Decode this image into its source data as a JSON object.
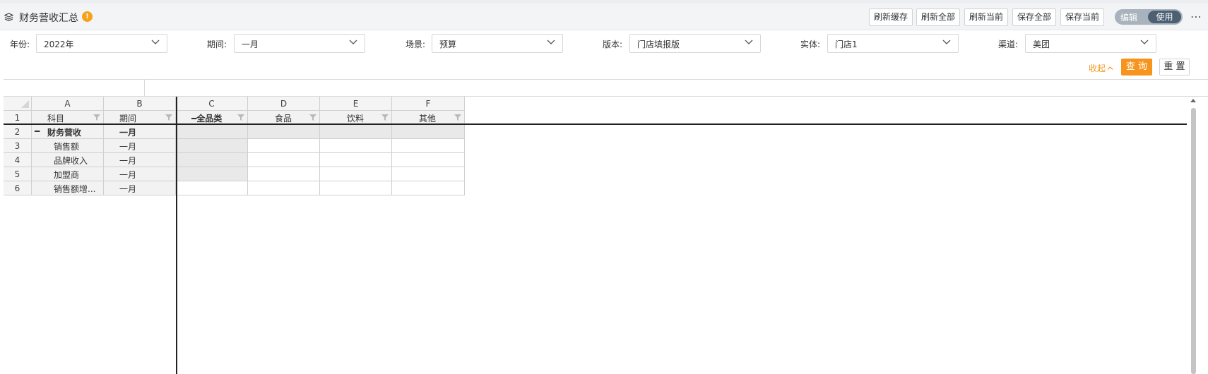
{
  "header": {
    "title": "财务营收汇总",
    "info_badge": "!",
    "buttons": [
      "刷新缓存",
      "刷新全部",
      "刷新当前",
      "保存全部",
      "保存当前"
    ],
    "mode_toggle": {
      "edit_label": "编辑",
      "use_label": "使用",
      "active": "使用"
    },
    "more_icon": "⋯",
    "icon": "layers-icon"
  },
  "filters": [
    {
      "label": "年份:",
      "value": "2022年"
    },
    {
      "label": "期间:",
      "value": "一月"
    },
    {
      "label": "场景:",
      "value": "预算"
    },
    {
      "label": "版本:",
      "value": "门店填报版"
    },
    {
      "label": "实体:",
      "value": "门店1"
    },
    {
      "label": "渠道:",
      "value": "美团"
    }
  ],
  "actions": {
    "collapse": "收起",
    "query": "查 询",
    "reset": "重 置"
  },
  "colors": {
    "accent": "#f7941d",
    "toggle_active": "#4d6073",
    "toggle_bg": "#a8b3bd"
  },
  "sheet": {
    "columns": [
      "A",
      "B",
      "C",
      "D",
      "E",
      "F"
    ],
    "row_numbers": [
      "1",
      "2",
      "3",
      "4",
      "5",
      "6"
    ],
    "header_row": [
      "科目",
      "期间",
      "━全品类",
      "食品",
      "饮料",
      "其他"
    ],
    "rows": [
      {
        "account": "财务营收",
        "collapse": "━",
        "period": "一月"
      },
      {
        "account": "销售额",
        "period": "一月"
      },
      {
        "account": "品牌收入",
        "period": "一月"
      },
      {
        "account": "加盟商",
        "period": "一月"
      },
      {
        "account": "销售额增...",
        "period": "一月"
      }
    ]
  }
}
